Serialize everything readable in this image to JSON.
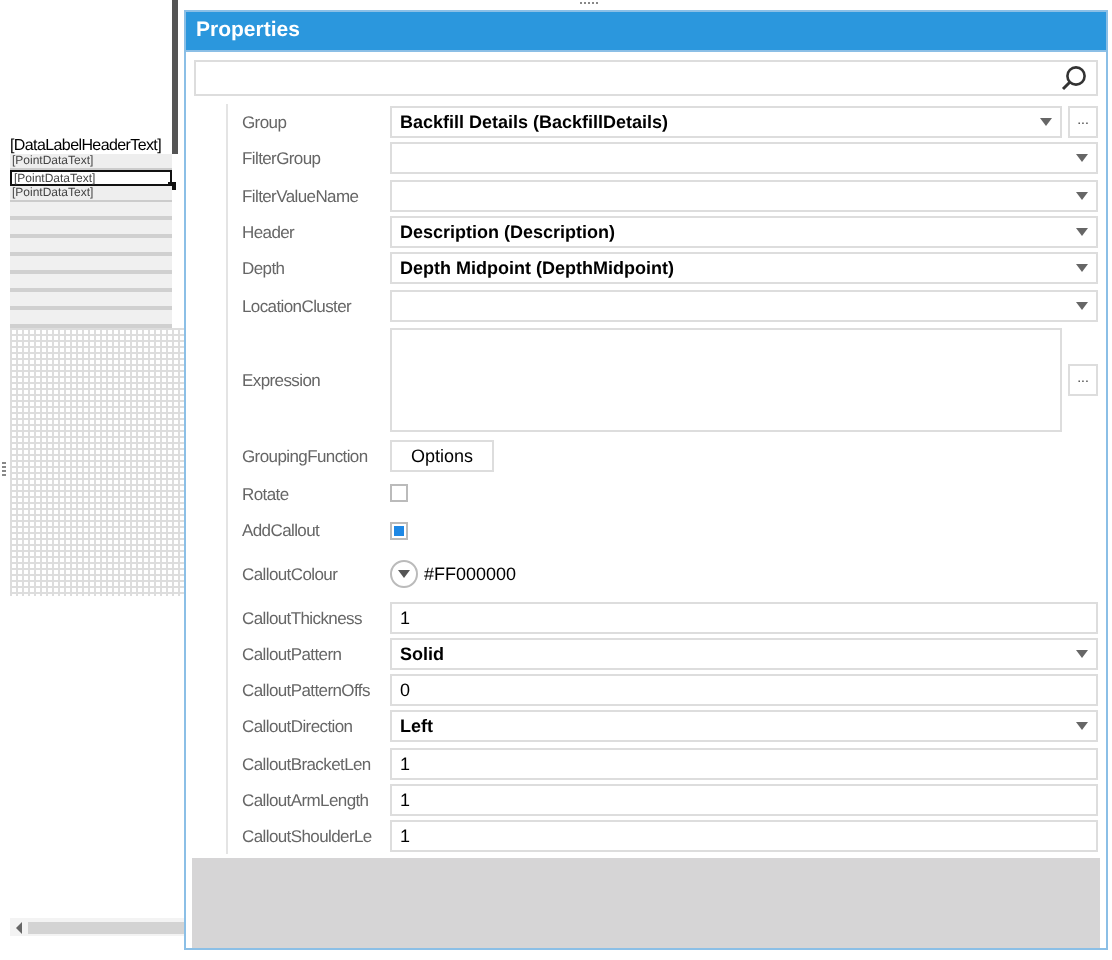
{
  "designer": {
    "header": "[DataLabelHeaderText]",
    "items": [
      {
        "text": "[PointDataText]",
        "selected": false
      },
      {
        "text": "[PointDataText]",
        "selected": true
      },
      {
        "text": "[PointDataText]",
        "selected": false
      }
    ]
  },
  "properties": {
    "title": "Properties",
    "rows": [
      {
        "label": "Group",
        "kind": "dropdown",
        "value": "Backfill Details (BackfillDetails)",
        "ellipsis": "..."
      },
      {
        "label": "FilterGroup",
        "kind": "dropdown"
      },
      {
        "label": "FilterValueName",
        "kind": "dropdown"
      },
      {
        "label": "Header",
        "kind": "dropdown",
        "value": "Description (Description)"
      },
      {
        "label": "Depth",
        "kind": "dropdown",
        "value": "Depth Midpoint (DepthMidpoint)"
      },
      {
        "label": "LocationCluster",
        "kind": "dropdown"
      },
      {
        "label": "Expression",
        "kind": "textarea",
        "ellipsis": "..."
      },
      {
        "label": "GroupingFunction",
        "kind": "button",
        "value": "Options"
      },
      {
        "label": "Rotate",
        "kind": "checkbox",
        "checked": false
      },
      {
        "label": "AddCallout",
        "kind": "checkbox",
        "checked": true
      },
      {
        "label": "CalloutColour",
        "kind": "color",
        "value": "#FF000000"
      },
      {
        "label": "CalloutThickness",
        "kind": "text",
        "value": "1"
      },
      {
        "label": "CalloutPattern",
        "kind": "dropdown",
        "value": "Solid"
      },
      {
        "label": "CalloutPatternOffs",
        "kind": "text",
        "value": "0"
      },
      {
        "label": "CalloutDirection",
        "kind": "dropdown",
        "value": "Left"
      },
      {
        "label": "CalloutBracketLen",
        "kind": "text",
        "value": "1"
      },
      {
        "label": "CalloutArmLength",
        "kind": "text",
        "value": "1"
      },
      {
        "label": "CalloutShoulderLe",
        "kind": "text",
        "value": "1"
      }
    ]
  }
}
